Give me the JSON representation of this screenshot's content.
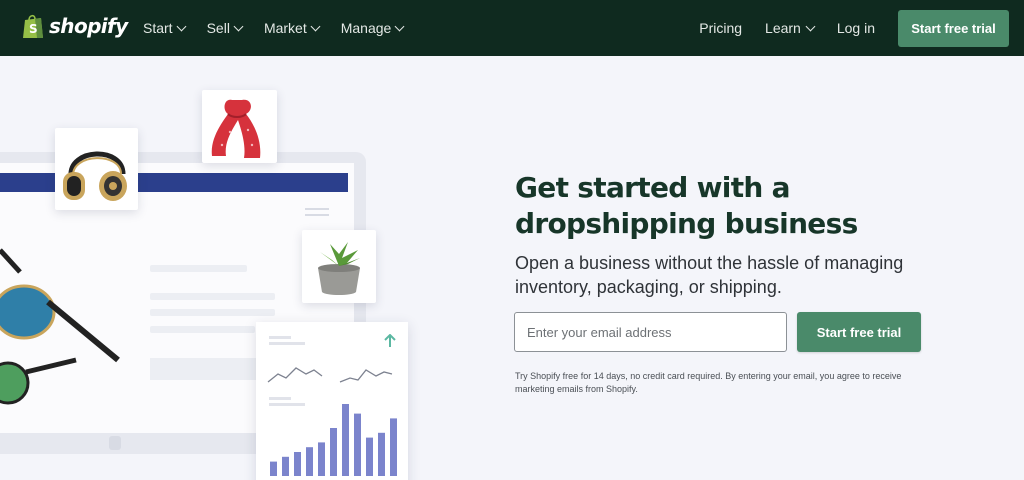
{
  "brand": {
    "name": "shopify",
    "color": "#95bf47"
  },
  "nav": {
    "items": [
      {
        "label": "Start"
      },
      {
        "label": "Sell"
      },
      {
        "label": "Market"
      },
      {
        "label": "Manage"
      }
    ],
    "right": {
      "pricing": "Pricing",
      "learn": "Learn",
      "login": "Log in",
      "cta": "Start free trial"
    }
  },
  "hero": {
    "title": "Get started with a dropshipping business",
    "subtitle": "Open a business without the hassle of managing inventory, packaging, or shipping.",
    "email_placeholder": "Enter your email address",
    "cta": "Start free trial",
    "fine_print": "Try Shopify free for 14 days, no credit card required. By entering your email, you agree to receive marketing emails from Shopify."
  },
  "illustration": {
    "products": [
      "headphones",
      "scarf",
      "succulent-plant",
      "sunglasses"
    ],
    "chart_values": [
      3,
      4,
      5,
      6,
      7,
      10,
      15,
      13,
      8,
      9,
      12
    ]
  },
  "colors": {
    "nav_bg": "#0f2a1f",
    "cta_green": "#4a8a6a",
    "title_green": "#173629",
    "chart_bar": "#7b84cc"
  }
}
